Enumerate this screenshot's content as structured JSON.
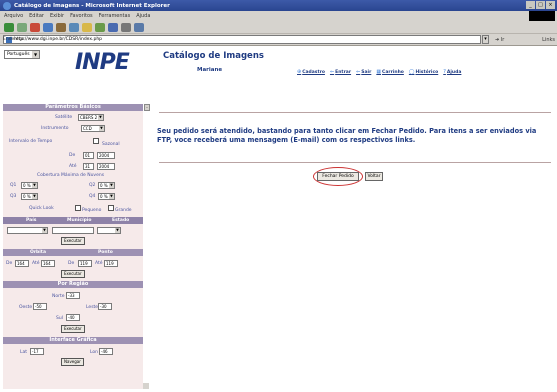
{
  "browser": {
    "window_title": "Catálogo de Imagens - Microsoft Internet Explorer",
    "menu": [
      "Arquivo",
      "Editar",
      "Exibir",
      "Favoritos",
      "Ferramentas",
      "Ajuda"
    ],
    "address_label": "Endereço",
    "url": "http://www.dgi.inpe.br/CDSR/index.php",
    "go_label": "Ir",
    "links_label": "Links"
  },
  "header": {
    "language": "Português",
    "logo": "INPE",
    "title": "Catálogo de Imagens",
    "user": "Mariane",
    "links": [
      {
        "icon": "⊕",
        "label": "Cadastro"
      },
      {
        "icon": "⇐",
        "label": "Entrar"
      },
      {
        "icon": "⇐",
        "label": "Sair"
      },
      {
        "icon": "▦",
        "label": "Carrinho"
      },
      {
        "icon": "◯",
        "label": "Histórico"
      },
      {
        "icon": "?",
        "label": "Ajuda"
      }
    ]
  },
  "sidebar": {
    "section_basic": "Parâmetros Básicos",
    "satellite_label": "Satélite",
    "satellite_value": "CBERS 2",
    "instrument_label": "Instrumento",
    "instrument_value": "CCD",
    "interval_label": "Intervalo de Tempo",
    "seasonal_label": "Sazonal",
    "from_label": "De",
    "from_day": "01",
    "from_year": "2004",
    "to_label": "Até",
    "to_day": "31",
    "to_year": "2004",
    "cloud_label": "Cobertura Máxima de Nuvens",
    "q_labels": [
      "Q1",
      "Q2",
      "Q3",
      "Q4"
    ],
    "q_value": "0 %",
    "quicklook_label": "Quick Look",
    "small_label": "Pequeno",
    "large_label": "Grande",
    "col_country": "País",
    "col_city": "Município",
    "col_state": "Estado",
    "search_label": "Executar",
    "orbit_label": "Órbita",
    "point_label": "Ponto",
    "orbit_from": "De",
    "orbit_from_val": "164",
    "orbit_to": "Até",
    "orbit_to_val": "164",
    "point_from": "De",
    "point_from_val": "119",
    "point_to": "Até",
    "point_to_val": "119",
    "region_label": "Por Região",
    "north_label": "Norte",
    "north_val": "-33",
    "west_label": "Oeste",
    "west_val": "-50",
    "east_label": "Leste",
    "east_val": "-30",
    "south_label": "Sul",
    "south_val": "-40",
    "graphic_label": "Interface Gráfica",
    "lat_label": "Lat",
    "lat_val": "-17",
    "lon_label": "Lon",
    "lon_val": "-46",
    "navigate_label": "Navegar"
  },
  "main": {
    "message": "Seu pedido será atendido, bastando para tanto clicar em Fechar Pedido. Para itens a ser enviados via FTP, voce receberá uma mensagem (E-mail) com os respectivos links.",
    "close_order": "Fechar Pedido",
    "back": "Voltar"
  }
}
